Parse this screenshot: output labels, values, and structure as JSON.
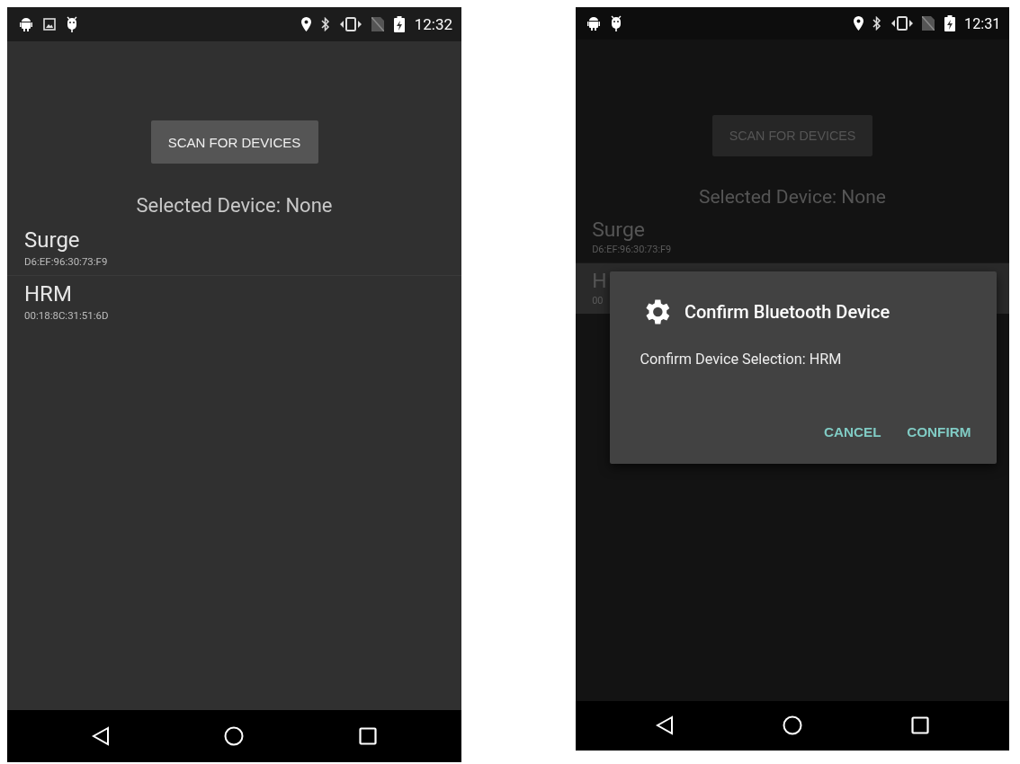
{
  "screens": [
    {
      "status_bar": {
        "notification_icons": [
          {
            "kind": "android"
          },
          {
            "kind": "image"
          },
          {
            "kind": "debug"
          }
        ],
        "time": "12:32"
      },
      "dimmed": false,
      "scan_button": "SCAN FOR DEVICES",
      "selected_device": "Selected Device: None",
      "devices": [
        {
          "name": "Surge",
          "address": "D6:EF:96:30:73:F9",
          "selected": false
        },
        {
          "name": "HRM",
          "address": "00:18:8C:31:51:6D",
          "selected": false
        }
      ]
    },
    {
      "status_bar": {
        "notification_icons": [
          {
            "kind": "android"
          },
          {
            "kind": "debug"
          }
        ],
        "time": "12:31"
      },
      "dimmed": true,
      "scan_button": "SCAN FOR DEVICES",
      "selected_device": "Selected Device: None",
      "devices": [
        {
          "name": "Surge",
          "address": "D6:EF:96:30:73:F9",
          "selected": false
        },
        {
          "name": "H",
          "address": "00",
          "selected": true
        }
      ],
      "dialog": {
        "title": "Confirm Bluetooth Device",
        "message": "Confirm Device Selection: HRM",
        "buttons": [
          "CANCEL",
          "CONFIRM"
        ]
      }
    }
  ]
}
